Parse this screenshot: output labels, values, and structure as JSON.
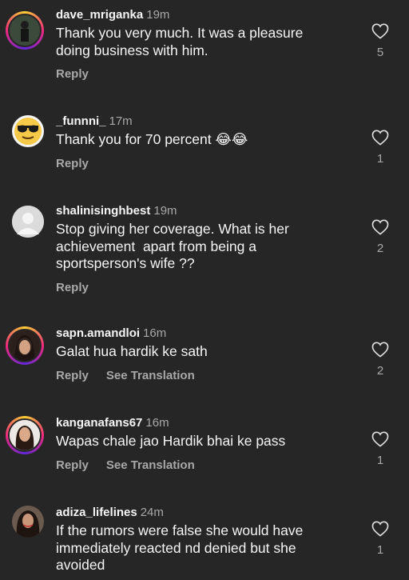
{
  "comments": [
    {
      "username": "dave_mriganka",
      "time": "19m",
      "text": "Thank you very much. It was a pleasure\ndoing business with him.",
      "reply": "Reply",
      "likes": "5"
    },
    {
      "username": "_funnni_",
      "time": "17m",
      "text": "Thank you for 70 percent 😂😂",
      "reply": "Reply",
      "likes": "1"
    },
    {
      "username": "shalinisinghbest",
      "time": "19m",
      "text": "Stop giving her coverage. What is her\nachievement  apart from being a\nsportsperson's wife ??",
      "reply": "Reply",
      "likes": "2"
    },
    {
      "username": "sapn.amandloi",
      "time": "16m",
      "text": "Galat hua hardik ke sath",
      "reply": "Reply",
      "translate": "See Translation",
      "likes": "2"
    },
    {
      "username": "kanganafans67",
      "time": "16m",
      "text": "Wapas chale jao Hardik bhai ke pass",
      "reply": "Reply",
      "translate": "See Translation",
      "likes": "1"
    },
    {
      "username": "adiza_lifelines",
      "time": "24m",
      "text": "If the rumors were false she would have\nimmediately reacted nd denied but she\navoided",
      "likes": "1"
    }
  ]
}
